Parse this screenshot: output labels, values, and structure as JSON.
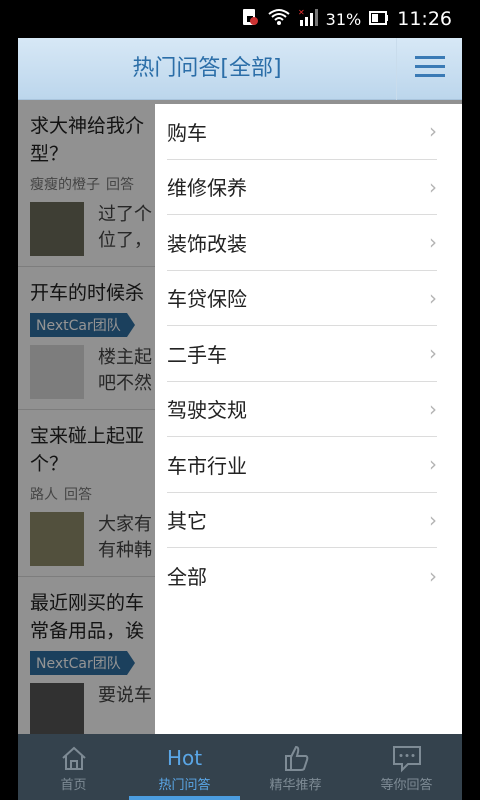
{
  "status_bar": {
    "battery": "31%",
    "time": "11:26"
  },
  "header": {
    "title": "热门问答[全部]"
  },
  "questions": [
    {
      "title": "求大神给我介",
      "title2": "型？",
      "author": "瘦瘦的橙子",
      "action": "回答",
      "preview1": "过了个",
      "preview2": "位了，"
    },
    {
      "title": "开车的时候杀",
      "author_badge": "NextCar团队",
      "preview1": "楼主起",
      "preview2": "吧不然"
    },
    {
      "title": "宝来碰上起亚",
      "title2": "个？",
      "author": "路人",
      "action": "回答",
      "preview1": "大家有",
      "preview2": "有种韩"
    },
    {
      "title": "最近刚买的车",
      "title2": "常备用品，诶",
      "author_badge": "NextCar团队",
      "preview1": "要说车"
    }
  ],
  "menu": {
    "items": [
      {
        "label": "购车"
      },
      {
        "label": "维修保养"
      },
      {
        "label": "装饰改装"
      },
      {
        "label": "车贷保险"
      },
      {
        "label": "二手车"
      },
      {
        "label": "驾驶交规"
      },
      {
        "label": "车市行业"
      },
      {
        "label": "其它"
      },
      {
        "label": "全部"
      }
    ]
  },
  "tabbar": {
    "tabs": [
      {
        "label": "首页",
        "icon": "home-icon"
      },
      {
        "label": "热门问答",
        "icon_text": "Hot"
      },
      {
        "label": "精华推荐",
        "icon": "thumbs-up-icon"
      },
      {
        "label": "等你回答",
        "icon": "chat-bubble-icon"
      }
    ]
  }
}
